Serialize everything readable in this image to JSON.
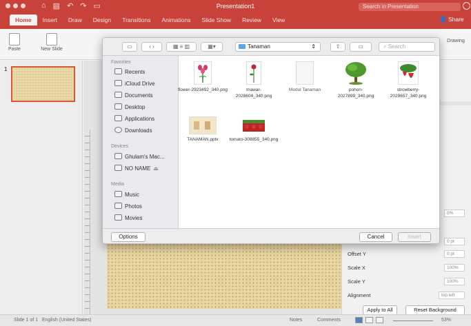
{
  "app": {
    "doc_title": "Presentation1",
    "search_placeholder": "Search in Presentation",
    "share": "Share",
    "tabs": [
      {
        "label": "Home",
        "active": true
      },
      {
        "label": "Insert"
      },
      {
        "label": "Draw"
      },
      {
        "label": "Design"
      },
      {
        "label": "Transitions"
      },
      {
        "label": "Animations"
      },
      {
        "label": "Slide Show"
      },
      {
        "label": "Review"
      },
      {
        "label": "View"
      }
    ],
    "ribbon": {
      "paste": "Paste",
      "new_slide": "New Slide",
      "drawing": "Drawing"
    },
    "accent": "#c8423a"
  },
  "thumbnails": {
    "slide_number": "1"
  },
  "dialog": {
    "location": "Tanaman",
    "search_placeholder": "Search",
    "sidebar": {
      "favorites_heading": "Favorites",
      "favorites": [
        "Recents",
        "iCloud Drive",
        "Documents",
        "Desktop",
        "Applications",
        "Downloads"
      ],
      "devices_heading": "Devices",
      "devices": [
        "Ghulam's Mac...",
        "NO NAME"
      ],
      "media_heading": "Media",
      "media": [
        "Music",
        "Photos",
        "Movies"
      ]
    },
    "files": [
      {
        "name": "flower-2923492_340.png"
      },
      {
        "name": "mawar-2028604_340.png"
      },
      {
        "name": "Modul Tanaman"
      },
      {
        "name": "pohon-2027899_340.png"
      },
      {
        "name": "strowberry-2029657_340.png"
      },
      {
        "name": "TANAMAN.pptx"
      },
      {
        "name": "tomato-308855_340.png"
      }
    ],
    "options_label": "Options",
    "cancel_label": "Cancel",
    "insert_label": "Insert"
  },
  "format_pane": {
    "offset_y_label": "Offset Y",
    "scale_x_label": "Scale X",
    "scale_y_label": "Scale Y",
    "alignment_label": "Alignment",
    "values": {
      "transparency": "0%",
      "offset_x": "0 pt",
      "offset_y": "0 pt",
      "scale_x": "100%",
      "scale_y": "100%",
      "alignment": "top left"
    },
    "apply_all": "Apply to All",
    "reset_background": "Reset Background"
  },
  "statusbar": {
    "slide_info": "Slide 1 of 1",
    "language": "English (United States)",
    "notes": "Notes",
    "comments": "Comments",
    "zoom": "53%"
  }
}
